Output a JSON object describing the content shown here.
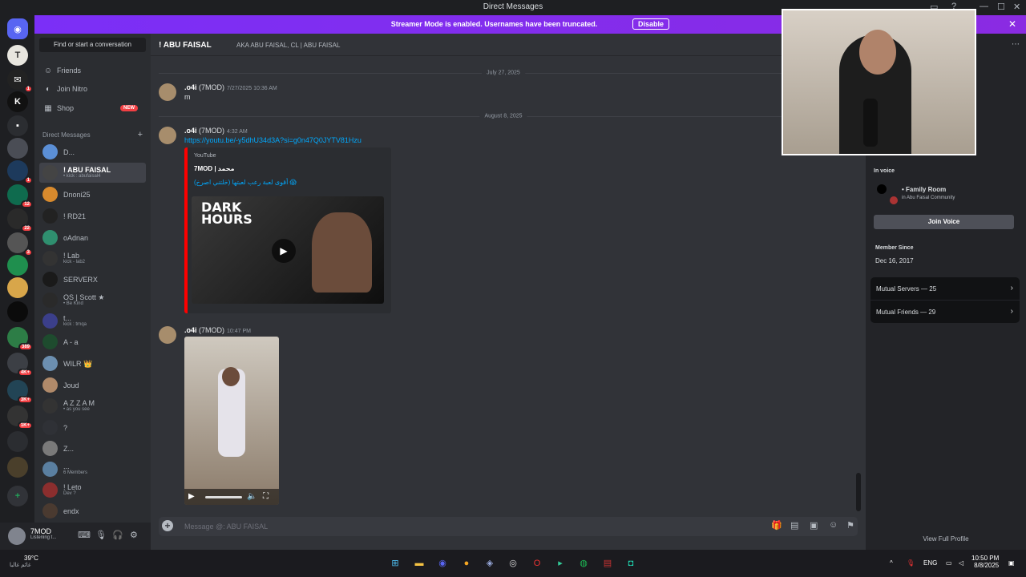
{
  "window": {
    "title": "Direct Messages"
  },
  "banner": {
    "text": "Streamer Mode is enabled. Usernames have been truncated.",
    "button": "Disable"
  },
  "sidebar": {
    "search": "Find or start a conversation",
    "nav": [
      {
        "label": "Friends",
        "icon": "friends-icon"
      },
      {
        "label": "Join Nitro",
        "icon": "nitro-icon"
      },
      {
        "label": "Shop",
        "icon": "shop-icon",
        "badge": "NEW"
      }
    ],
    "dm_header": "Direct Messages",
    "dms": [
      {
        "name": "D...",
        "sub": ""
      },
      {
        "name": "! ABU FAISAL",
        "sub": "• kick : abufaisal4"
      },
      {
        "name": "Dnoni25",
        "sub": ""
      },
      {
        "name": "! RD21",
        "sub": ""
      },
      {
        "name": "oAdnan",
        "sub": ""
      },
      {
        "name": "! Lab",
        "sub": "kick - lab2"
      },
      {
        "name": "SERVERX",
        "sub": ""
      },
      {
        "name": "OS | Scott ★",
        "sub": "• Be Kind"
      },
      {
        "name": "t...",
        "sub": "kick : trnqa"
      },
      {
        "name": "A - a",
        "sub": ""
      },
      {
        "name": "WILR 👑",
        "sub": ""
      },
      {
        "name": "Joud",
        "sub": ""
      },
      {
        "name": "A Z Z A M",
        "sub": "• as you see"
      },
      {
        "name": "?",
        "sub": ""
      },
      {
        "name": "Z...",
        "sub": ""
      },
      {
        "name": "...",
        "sub": "6 Members"
      },
      {
        "name": "! Leto",
        "sub": "Dev ?"
      },
      {
        "name": "endx",
        "sub": ""
      }
    ],
    "user": {
      "name": "7MOD",
      "status": "Listening t..."
    }
  },
  "chat": {
    "header_name": "! ABU FAISAL",
    "header_aka": "AKA  ABU FAISAL, CL | ABU FAISAL",
    "dates": [
      "July 27, 2025",
      "August 8, 2025"
    ],
    "messages": [
      {
        "author": ".o4i",
        "tag": "(7MOD)",
        "time": "7/27/2025 10:36 AM",
        "text": "m"
      },
      {
        "author": ".o4i",
        "tag": "(7MOD)",
        "time": "4:32 AM",
        "text": "https://youtu.be/-y5dhU34d3A?si=g0n47Q0JYTV81Hzu"
      },
      {
        "author": ".o4i",
        "tag": "(7MOD)",
        "time": "10:47 PM",
        "text": ""
      }
    ],
    "embed": {
      "provider": "YouTube",
      "author": "7MOD | محمد",
      "title": "أقوى لعبة رعب لعبتها (خلتني اصرخ) 😱",
      "thumb_text": "DARK HOURS"
    },
    "composer_placeholder": "Message @: ABU FAISAL"
  },
  "profile": {
    "in_voice_label": "In voice",
    "voice_channel": "• Family Room",
    "voice_server": "in Abu Faisal Community",
    "join_voice": "Join Voice",
    "member_since_label": "Member Since",
    "member_since": "Dec 16, 2017",
    "mutual_servers": "Mutual Servers — 25",
    "mutual_friends": "Mutual Friends — 29",
    "view_full": "View Full Profile"
  },
  "taskbar": {
    "temp": "39°C",
    "condition": "غائم غالبا",
    "lang": "ENG",
    "time": "10:50 PM",
    "date": "8/8/2025"
  },
  "colors": {
    "accent": "#5865f2",
    "banner": "#8a2be2",
    "link": "#00a8fc",
    "danger": "#f23f43"
  }
}
